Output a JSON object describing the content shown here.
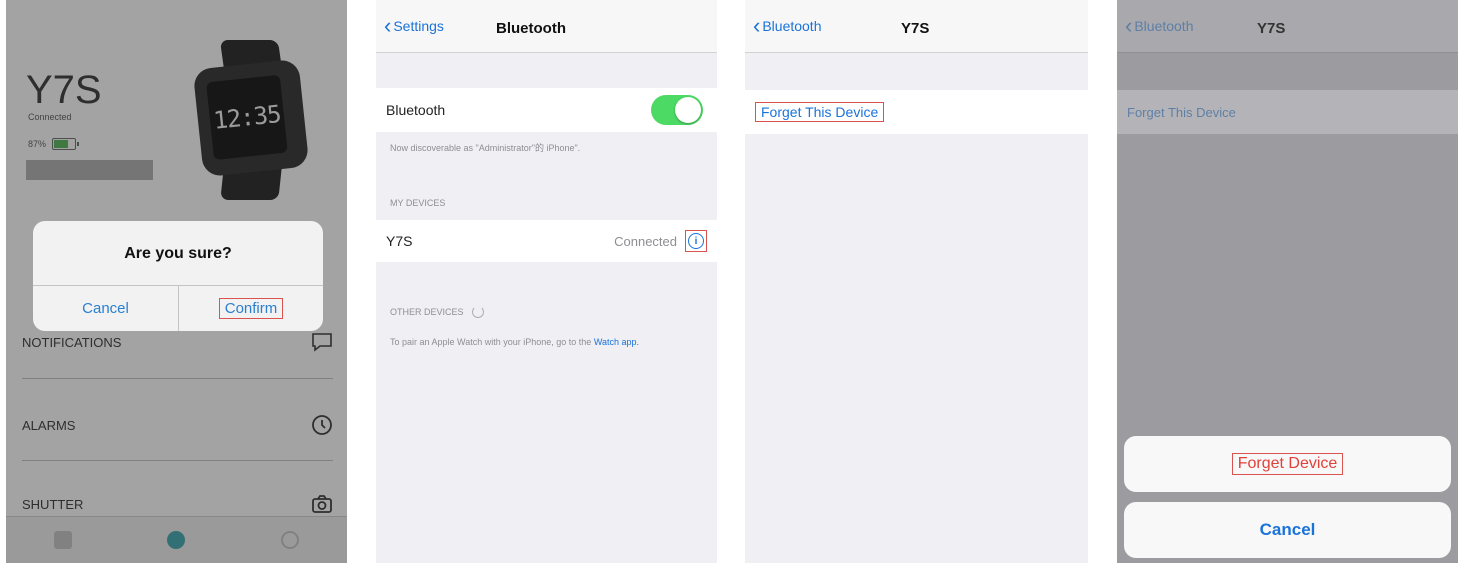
{
  "panel1": {
    "device_name": "Y7S",
    "device_status": "Connected",
    "battery_label": "87%",
    "watch_time": "12:35",
    "menu": {
      "notifications": "NOTIFICATIONS",
      "alarms": "ALARMS",
      "shutter": "SHUTTER"
    },
    "alert": {
      "title": "Are you sure?",
      "cancel": "Cancel",
      "confirm": "Confirm"
    }
  },
  "panel2": {
    "back_label": "Settings",
    "title": "Bluetooth",
    "bluetooth_label": "Bluetooth",
    "discoverable_text": "Now discoverable as \"Administrator\"的 iPhone\".",
    "my_devices_header": "MY DEVICES",
    "device_name": "Y7S",
    "device_status": "Connected",
    "other_devices_header": "OTHER DEVICES",
    "pair_text": "To pair an Apple Watch with your iPhone, go to the",
    "watch_app_link": "Watch app."
  },
  "panel3": {
    "back_label": "Bluetooth",
    "title": "Y7S",
    "forget_label": "Forget This Device"
  },
  "panel4": {
    "back_label": "Bluetooth",
    "title": "Y7S",
    "forget_label": "Forget This Device",
    "forget_device_button": "Forget Device",
    "cancel_button": "Cancel"
  },
  "colors": {
    "ios_blue": "#1a73d9",
    "toggle_green": "#4cd964",
    "highlight_red": "#d9534f"
  }
}
